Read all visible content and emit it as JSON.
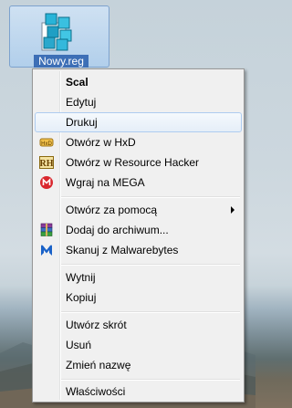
{
  "desktop_icon": {
    "label": "Nowy.reg",
    "icon": "registry-file-icon"
  },
  "context_menu": {
    "items": [
      {
        "label": "Scal",
        "bold": true,
        "icon": null
      },
      {
        "label": "Edytuj",
        "icon": null
      },
      {
        "label": "Drukuj",
        "icon": null,
        "highlighted": true
      },
      {
        "label": "Otwórz w HxD",
        "icon": "hxd-icon"
      },
      {
        "label": "Otwórz w Resource Hacker",
        "icon": "resource-hacker-icon"
      },
      {
        "label": "Wgraj na MEGA",
        "icon": "mega-icon"
      },
      {
        "label": "Otwórz za pomocą",
        "icon": null,
        "submenu": true
      },
      {
        "label": "Dodaj do archiwum...",
        "icon": "winrar-icon"
      },
      {
        "label": "Skanuj z Malwarebytes",
        "icon": "malwarebytes-icon"
      },
      {
        "label": "Wytnij",
        "icon": null
      },
      {
        "label": "Kopiuj",
        "icon": null
      },
      {
        "label": "Utwórz skrót",
        "icon": null
      },
      {
        "label": "Usuń",
        "icon": null
      },
      {
        "label": "Zmień nazwę",
        "icon": null
      },
      {
        "label": "Właściwości",
        "icon": null
      }
    ],
    "icon_colors": {
      "hxd": "#e0a020",
      "resource_hacker": "#c8a028",
      "mega": "#d9272e",
      "winrar": "#7a3a8a",
      "malwarebytes": "#1a62c8"
    }
  }
}
